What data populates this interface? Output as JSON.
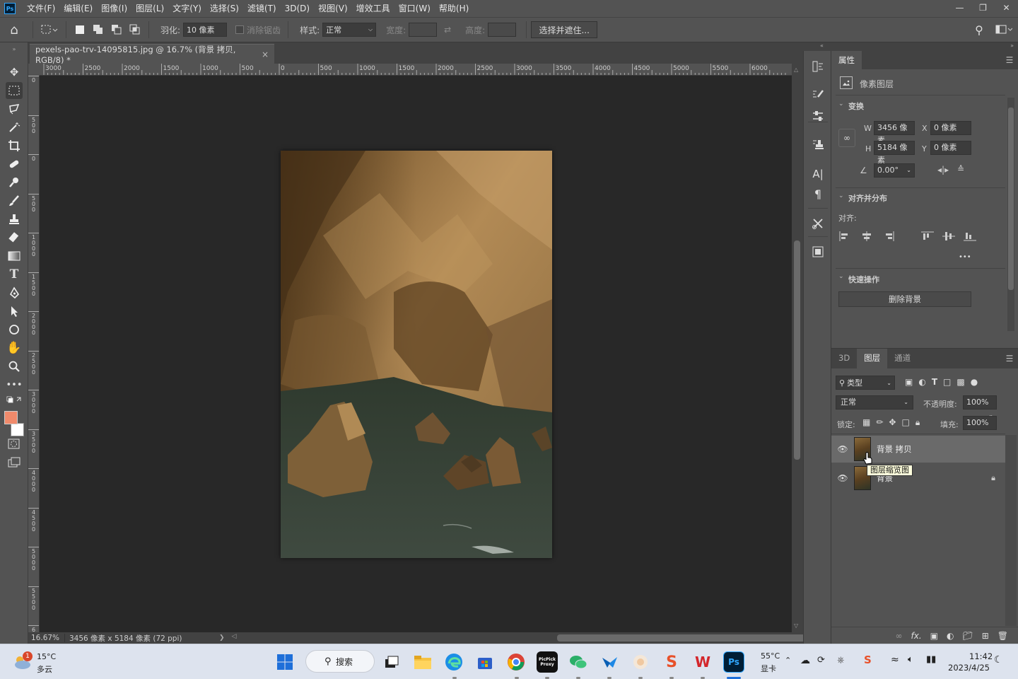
{
  "app": {
    "logo": "Ps"
  },
  "menu": [
    "文件(F)",
    "编辑(E)",
    "图像(I)",
    "图层(L)",
    "文字(Y)",
    "选择(S)",
    "滤镜(T)",
    "3D(D)",
    "视图(V)",
    "增效工具",
    "窗口(W)",
    "帮助(H)"
  ],
  "options": {
    "feather_label": "羽化:",
    "feather_value": "10 像素",
    "antialias_label": "消除锯齿",
    "style_label": "样式:",
    "style_value": "正常",
    "width_label": "宽度:",
    "height_label": "高度:",
    "select_mask_label": "选择并遮住..."
  },
  "document": {
    "tab_title": "pexels-pao-trv-14095815.jpg @ 16.7% (背景 拷贝, RGB/8) *",
    "close": "×",
    "zoom": "16.67%",
    "info": "3456 像素 x 5184 像素 (72 ppi)",
    "info_arrow": "❯"
  },
  "ruler": {
    "h_ticks": [
      "3000",
      "2500",
      "2000",
      "1500",
      "1000",
      "500",
      "0",
      "500",
      "1000",
      "1500",
      "2000",
      "2500",
      "3000",
      "3500",
      "4000",
      "4500",
      "5000",
      "5500",
      "6000"
    ],
    "v_ticks": [
      "0",
      "500",
      "0",
      "500",
      "1000",
      "1500",
      "2000",
      "2500",
      "3000",
      "3500",
      "4000",
      "4500",
      "5000",
      "5500",
      "6"
    ]
  },
  "properties": {
    "tab": "属性",
    "layer_type": "像素图层",
    "transform_title": "变换",
    "w_label": "W",
    "w_value": "3456 像素",
    "h_label": "H",
    "h_value": "5184 像素",
    "x_label": "X",
    "x_value": "0 像素",
    "y_label": "Y",
    "y_value": "0 像素",
    "angle_value": "0.00°",
    "align_title": "对齐并分布",
    "align_label": "对齐:",
    "more": "•••",
    "quick_title": "快速操作",
    "remove_bg": "删除背景"
  },
  "layers": {
    "tabs": [
      "3D",
      "图层",
      "通道"
    ],
    "filter_label": "类型",
    "blend_mode": "正常",
    "opacity_label": "不透明度:",
    "opacity_value": "100%",
    "lock_label": "锁定:",
    "fill_label": "填充:",
    "fill_value": "100%",
    "items": [
      {
        "name": "背景 拷贝",
        "selected": true
      },
      {
        "name": "背景",
        "locked": true
      }
    ],
    "tooltip": "图层缩览图",
    "footer_fx": "fx."
  },
  "taskbar": {
    "weather_temp": "15°C",
    "weather_desc": "多云",
    "weather_badge": "1",
    "search_label": "搜索",
    "cpu_temp": "55°C",
    "cpu_label": "显卡",
    "time": "11:42",
    "date": "2023/4/25",
    "app_labels": {
      "picpick": "PicPick Proxy",
      "ps": "Ps",
      "wps": "W",
      "sogou": "S"
    }
  }
}
